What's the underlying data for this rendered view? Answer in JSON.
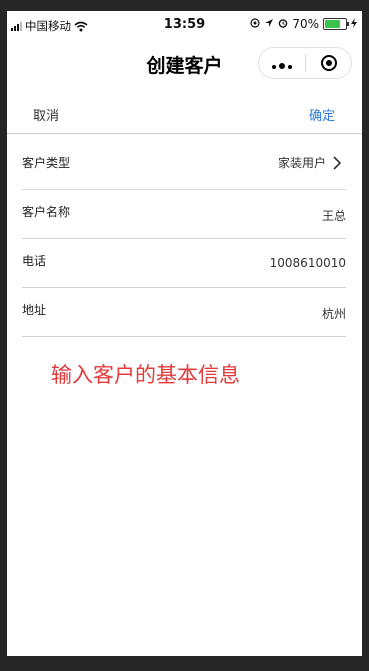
{
  "status_bar": {
    "carrier": "中国移动",
    "time": "13:59",
    "battery_percent": "70%",
    "battery_level": 0.7,
    "icons": [
      "signal-icon",
      "wifi-icon",
      "location-icon",
      "alarm-icon",
      "battery-icon",
      "charging-icon"
    ]
  },
  "nav": {
    "title": "创建客户",
    "capsule": {
      "more_icon": "more-dots-icon",
      "close_icon": "target-circle-icon"
    }
  },
  "actions": {
    "cancel_label": "取消",
    "confirm_label": "确定",
    "confirm_color": "#2b7bd6"
  },
  "form": {
    "fields": [
      {
        "label": "客户类型",
        "value": "家装用户",
        "has_arrow": true
      },
      {
        "label": "客户名称",
        "value": "王总",
        "has_arrow": false
      },
      {
        "label": "电话",
        "value": "1008610010",
        "has_arrow": false
      },
      {
        "label": "地址",
        "value": "杭州",
        "has_arrow": false
      }
    ]
  },
  "annotation": {
    "text": "输入客户的基本信息",
    "color": "#e23b3b"
  }
}
